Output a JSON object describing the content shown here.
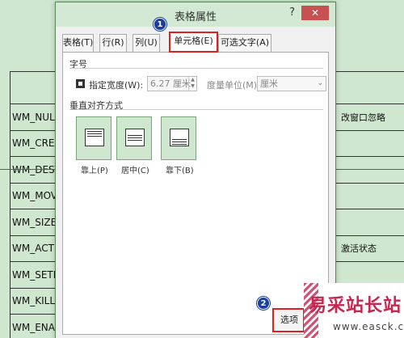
{
  "background_doc": {
    "rows": [
      {
        "name": "",
        "note": ""
      },
      {
        "name": "WM_NULL",
        "note": "改窗口忽略"
      },
      {
        "name": "WM_CREA",
        "note": ""
      },
      {
        "name": "WM_DEST",
        "note": ""
      },
      {
        "name": "WM_MOV",
        "note": ""
      },
      {
        "name": "WM_SIZE",
        "note": ""
      },
      {
        "name": "WM_ACTIV",
        "note": "激活状态"
      },
      {
        "name": "WM_SETF(",
        "note": ""
      },
      {
        "name": "WM_KILLF",
        "note": ""
      },
      {
        "name": "WM_ENAE",
        "note": ""
      }
    ]
  },
  "dialog": {
    "title": "表格属性",
    "help": "?",
    "close": "✕",
    "tabs": [
      {
        "label": "表格(T)"
      },
      {
        "label": "行(R)"
      },
      {
        "label": "列(U)"
      },
      {
        "label": "单元格(E)",
        "active": true
      },
      {
        "label": "可选文字(A)"
      }
    ],
    "size_section": {
      "title": "字号",
      "width_label": "指定宽度(W):",
      "width_value": "6.27 厘米",
      "unit_label": "度量单位(M):",
      "unit_value": "厘米"
    },
    "valign_section": {
      "title": "垂直对齐方式",
      "options": [
        {
          "label": "靠上(P)",
          "icon": "align-top-icon"
        },
        {
          "label": "居中(C)",
          "icon": "align-middle-icon"
        },
        {
          "label": "靠下(B)",
          "icon": "align-bottom-icon"
        }
      ]
    },
    "options_button": "选项",
    "markers": [
      "1",
      "2"
    ]
  },
  "watermark": {
    "text": "易采站长站",
    "url": "www.easck.com"
  },
  "colors": {
    "background": "#cfe6cf",
    "highlight_red": "#e02020",
    "marker_blue": "#1a3fa0",
    "close_red": "#c75050"
  }
}
